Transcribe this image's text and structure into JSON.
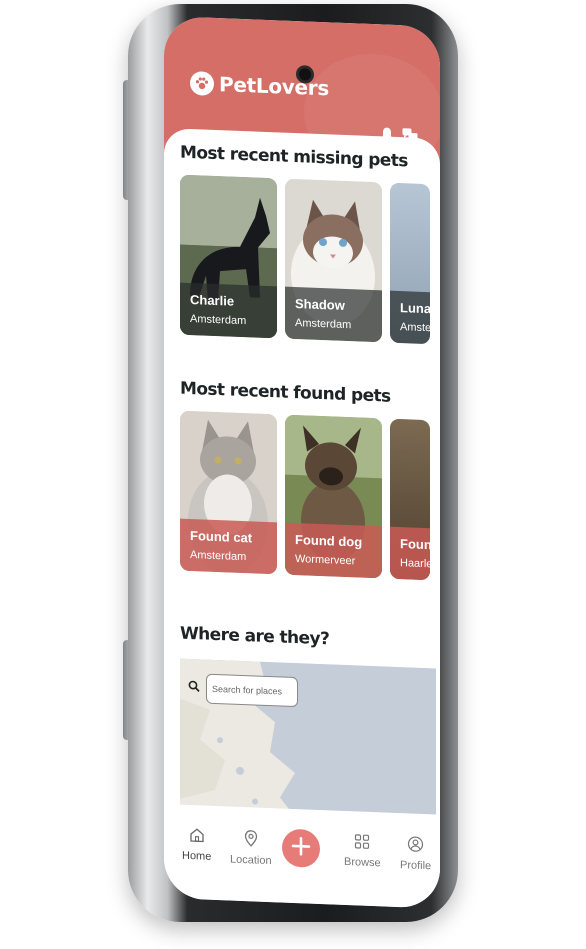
{
  "app": {
    "name": "PetLovers"
  },
  "colors": {
    "brand": "#d46e66",
    "fab": "#e77b78",
    "missing_overlay": "#333d3a",
    "found_overlay": "#c95b55"
  },
  "header": {
    "icons": [
      "bell-icon",
      "chat-icon"
    ]
  },
  "sections": {
    "missing": {
      "title": "Most recent missing pets",
      "cards": [
        {
          "name": "Charlie",
          "place": "Amsterdam"
        },
        {
          "name": "Shadow",
          "place": "Amsterdam"
        },
        {
          "name": "Luna",
          "place": "Amste"
        }
      ]
    },
    "found": {
      "title": "Most recent found pets",
      "cards": [
        {
          "name": "Found cat",
          "place": "Amsterdam"
        },
        {
          "name": "Found dog",
          "place": "Wormerveer"
        },
        {
          "name": "Found",
          "place": "Haarlem"
        }
      ]
    },
    "map": {
      "title": "Where are they?",
      "search_placeholder": "Search for places"
    }
  },
  "nav": {
    "items": [
      {
        "label": "Home",
        "icon": "home-icon"
      },
      {
        "label": "Location",
        "icon": "location-pin-icon"
      },
      {
        "label": "",
        "icon": "plus-icon"
      },
      {
        "label": "Browse",
        "icon": "grid-icon"
      },
      {
        "label": "Profile",
        "icon": "user-circle-icon"
      }
    ]
  }
}
